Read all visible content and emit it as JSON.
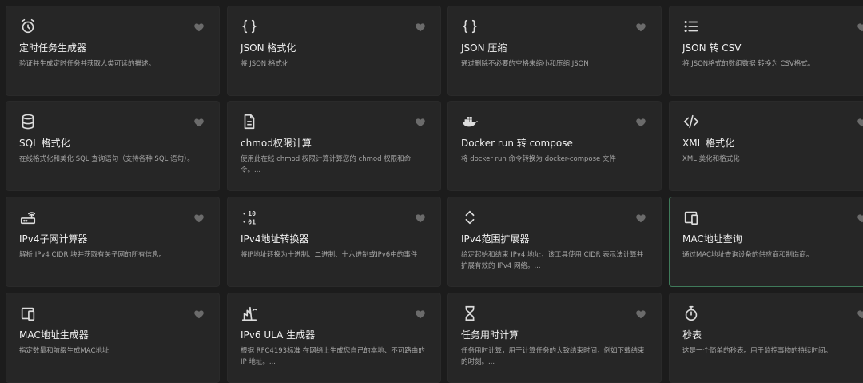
{
  "tools": [
    {
      "title": "定时任务生成器",
      "desc": "验证并生成定时任务并获取人类可读的描述。",
      "icon": "alarm-clock-icon"
    },
    {
      "title": "JSON 格式化",
      "desc": "将 JSON 格式化",
      "icon": "braces-icon"
    },
    {
      "title": "JSON 压缩",
      "desc": "通过删除不必要的空格来缩小和压缩 JSON",
      "icon": "braces-icon"
    },
    {
      "title": "JSON 转 CSV",
      "desc": "将 JSON格式的数组数据 转换为 CSV格式。",
      "icon": "list-icon"
    },
    {
      "title": "SQL 格式化",
      "desc": "在线格式化和美化 SQL 查询语句（支持各种 SQL 语句）。",
      "icon": "database-icon"
    },
    {
      "title": "chmod权限计算",
      "desc": "使用此在线 chmod 权限计算计算您的 chmod 权限和命令。...",
      "icon": "file-text-icon"
    },
    {
      "title": "Docker run 转 compose",
      "desc": "将 docker run 命令转换为 docker-compose 文件",
      "icon": "docker-icon"
    },
    {
      "title": "XML 格式化",
      "desc": "XML 美化和格式化",
      "icon": "code-icon"
    },
    {
      "title": "IPv4子网计算器",
      "desc": "解析 IPv4 CIDR 块并获取有关子网的所有信息。",
      "icon": "router-icon"
    },
    {
      "title": "IPv4地址转换器",
      "desc": "将IP地址转换为十进制、二进制、十六进制或IPv6中的事件",
      "icon": "binary-icon"
    },
    {
      "title": "IPv4范围扩展器",
      "desc": "给定起始和结束 IPv4 地址，该工具使用 CIDR 表示法计算并扩展有效的 IPv4 网络。...",
      "icon": "unfold-icon"
    },
    {
      "title": "MAC地址查询",
      "desc": "通过MAC地址查询设备的供应商和制造商。",
      "icon": "devices-icon"
    },
    {
      "title": "MAC地址生成器",
      "desc": "指定数量和前缀生成MAC地址",
      "icon": "devices-icon"
    },
    {
      "title": "IPv6 ULA 生成器",
      "desc": "根据 RFC4193标准 在网络上生成您自己的本地、不可路由的 IP 地址。...",
      "icon": "plant-icon"
    },
    {
      "title": "任务用时计算",
      "desc": "任务用时计算，用于计算任务的大致结束时间，例如下载结束的时刻。...",
      "icon": "hourglass-icon"
    },
    {
      "title": "秒表",
      "desc": "这是一个简单的秒表。用于监控事物的持续时间。",
      "icon": "stopwatch-icon"
    }
  ],
  "favorite_icon": "heart-icon",
  "colors": {
    "card_bg": "#262626",
    "page_bg": "#1c1c1c",
    "active_border": "#3f7a5a"
  }
}
